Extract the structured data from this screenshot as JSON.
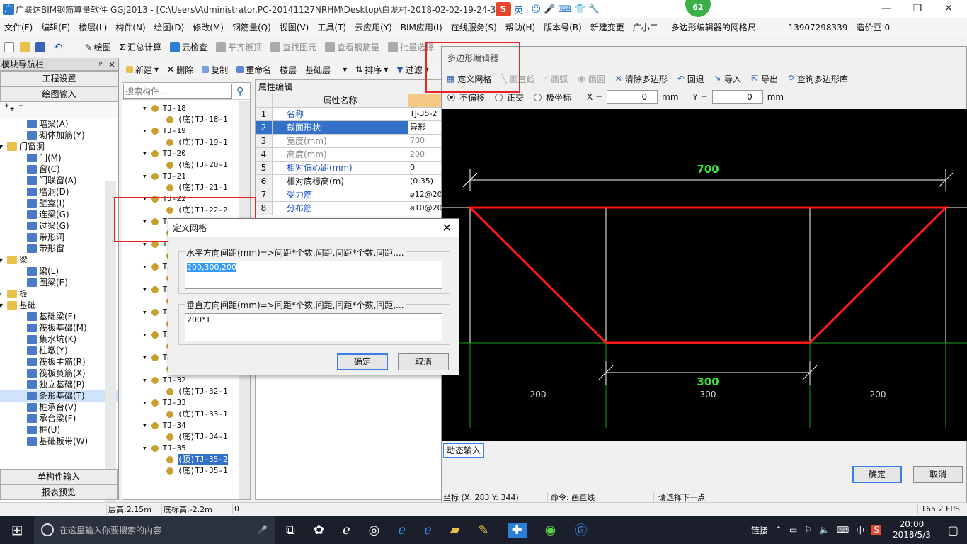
{
  "window": {
    "title": "广联达BIM钢筋算量软件 GGJ2013 - [C:\\Users\\Administrator.PC-20141127NRHM\\Desktop\\白龙村-2018-02-02-19-24-35",
    "notif_count": "62",
    "ime_label": "英"
  },
  "menubar": [
    "文件(F)",
    "编辑(E)",
    "楼层(L)",
    "构件(N)",
    "绘图(D)",
    "修改(M)",
    "钢筋量(Q)",
    "视图(V)",
    "工具(T)",
    "云应用(Y)",
    "BIM应用(I)",
    "在线服务(S)",
    "帮助(H)",
    "版本号(B)",
    "新建变更",
    "广小二",
    "多边形编辑器的网格尺..",
    "13907298339",
    "造价豆:0"
  ],
  "toolbar1": [
    "绘图",
    "汇总计算",
    "云检查",
    "平齐板顶",
    "查找图元",
    "查看钢筋量",
    "批量选择"
  ],
  "nav": {
    "header": "模块导航栏",
    "pin": "ᵖ",
    "close": "×",
    "btn_project": "工程设置",
    "btn_draw": "绘图输入",
    "tree": [
      {
        "text": "暗梁(A)",
        "indent": 3,
        "icon": "beam"
      },
      {
        "text": "砌体加筋(Y)",
        "indent": 3,
        "icon": "beam"
      },
      {
        "text": "门窗洞",
        "indent": 1,
        "icon": "folder",
        "expand": "▾"
      },
      {
        "text": "门(M)",
        "indent": 3,
        "icon": "door"
      },
      {
        "text": "窗(C)",
        "indent": 3,
        "icon": "window"
      },
      {
        "text": "门联窗(A)",
        "indent": 3,
        "icon": "door"
      },
      {
        "text": "墙洞(D)",
        "indent": 3,
        "icon": "wall"
      },
      {
        "text": "壁龛(I)",
        "indent": 3,
        "icon": "wall"
      },
      {
        "text": "连梁(G)",
        "indent": 3,
        "icon": "beam"
      },
      {
        "text": "过梁(G)",
        "indent": 3,
        "icon": "beam"
      },
      {
        "text": "带形洞",
        "indent": 3,
        "icon": "wall"
      },
      {
        "text": "带形窗",
        "indent": 3,
        "icon": "window"
      },
      {
        "text": "梁",
        "indent": 1,
        "icon": "folder",
        "expand": "▾"
      },
      {
        "text": "梁(L)",
        "indent": 3,
        "icon": "beam"
      },
      {
        "text": "圈梁(E)",
        "indent": 3,
        "icon": "beam"
      },
      {
        "text": "板",
        "indent": 1,
        "icon": "folder",
        "expand": "›"
      },
      {
        "text": "基础",
        "indent": 1,
        "icon": "folder",
        "expand": "▾"
      },
      {
        "text": "基础梁(F)",
        "indent": 3,
        "icon": "beam"
      },
      {
        "text": "筏板基础(M)",
        "indent": 3,
        "icon": "beam"
      },
      {
        "text": "集水坑(K)",
        "indent": 3,
        "icon": "beam"
      },
      {
        "text": "柱墩(Y)",
        "indent": 3,
        "icon": "beam"
      },
      {
        "text": "筏板主筋(R)",
        "indent": 3,
        "icon": "beam"
      },
      {
        "text": "筏板负筋(X)",
        "indent": 3,
        "icon": "beam"
      },
      {
        "text": "独立基础(P)",
        "indent": 3,
        "icon": "beam"
      },
      {
        "text": "条形基础(T)",
        "indent": 3,
        "icon": "beam",
        "selected": true
      },
      {
        "text": "桩承台(V)",
        "indent": 3,
        "icon": "beam"
      },
      {
        "text": "承台梁(F)",
        "indent": 3,
        "icon": "beam"
      },
      {
        "text": "桩(U)",
        "indent": 3,
        "icon": "beam"
      },
      {
        "text": "基础板带(W)",
        "indent": 3,
        "icon": "beam"
      }
    ],
    "btn_single": "单构件输入",
    "btn_report": "报表预览"
  },
  "comptool": [
    "新建",
    "删除",
    "复制",
    "重命名",
    "楼层",
    "基础层",
    "排序",
    "过滤"
  ],
  "search": {
    "placeholder": "搜索构件..."
  },
  "components": [
    {
      "text": "TJ-18",
      "sub": false
    },
    {
      "text": "(底)TJ-18-1",
      "sub": true
    },
    {
      "text": "TJ-19",
      "sub": false
    },
    {
      "text": "(底)TJ-19-1",
      "sub": true
    },
    {
      "text": "TJ-20",
      "sub": false
    },
    {
      "text": "(底)TJ-20-1",
      "sub": true
    },
    {
      "text": "TJ-21",
      "sub": false
    },
    {
      "text": "(底)TJ-21-1",
      "sub": true
    },
    {
      "text": "TJ-22",
      "sub": false
    },
    {
      "text": "(底)TJ-22-2",
      "sub": true
    },
    {
      "text": "TJ-23",
      "sub": false
    },
    {
      "text": "(底)TJ-23-1",
      "sub": true
    },
    {
      "text": "TJ-24",
      "sub": false
    },
    {
      "text": "(底)TJ-24-1",
      "sub": true
    },
    {
      "text": "TJ-25",
      "sub": false
    },
    {
      "text": "(底)TJ-25-1",
      "sub": true
    },
    {
      "text": "TJ-26",
      "sub": false
    },
    {
      "text": "(底)TJ-26-1",
      "sub": true
    },
    {
      "text": "TJ-27",
      "sub": false
    },
    {
      "text": "(底)TJ-27-1",
      "sub": true
    },
    {
      "text": "TJ-28",
      "sub": false
    },
    {
      "text": "(底)TJ-28-1",
      "sub": true
    },
    {
      "text": "TJ-31",
      "sub": false
    },
    {
      "text": "(底)TJ-31-1",
      "sub": true
    },
    {
      "text": "TJ-32",
      "sub": false
    },
    {
      "text": "(底)TJ-32-1",
      "sub": true
    },
    {
      "text": "TJ-33",
      "sub": false
    },
    {
      "text": "(底)TJ-33-1",
      "sub": true
    },
    {
      "text": "TJ-34",
      "sub": false
    },
    {
      "text": "(底)TJ-34-1",
      "sub": true
    },
    {
      "text": "TJ-35",
      "sub": false
    },
    {
      "text": "(顶)TJ-35-2",
      "sub": true,
      "selected": true
    },
    {
      "text": "(底)TJ-35-1",
      "sub": true
    }
  ],
  "props": {
    "tab": "属性编辑",
    "col_name": "属性名称",
    "rows": [
      {
        "n": "1",
        "k": "名称",
        "v": "TJ-35-2",
        "blue": true
      },
      {
        "n": "2",
        "k": "截面形状",
        "v": "异形",
        "blue": true,
        "selected": true
      },
      {
        "n": "3",
        "k": "宽度(mm)",
        "v": "700",
        "gray": true
      },
      {
        "n": "4",
        "k": "高度(mm)",
        "v": "200",
        "gray": true
      },
      {
        "n": "5",
        "k": "相对偏心距(mm)",
        "v": "0",
        "blue": true
      },
      {
        "n": "6",
        "k": "相对底标高(m)",
        "v": "(0.35)"
      },
      {
        "n": "7",
        "k": "受力筋",
        "v": "⌀12@20",
        "blue": true
      },
      {
        "n": "8",
        "k": "分布筋",
        "v": "⌀10@20",
        "blue": true
      }
    ]
  },
  "editor": {
    "title": "多边形编辑器",
    "tools": [
      {
        "label": "定义网格",
        "enabled": true,
        "icon": "grid-icon"
      },
      {
        "label": "画直线",
        "enabled": false,
        "icon": "line-icon"
      },
      {
        "label": "画弧",
        "enabled": false,
        "icon": "arc-icon"
      },
      {
        "label": "画圆",
        "enabled": false,
        "icon": "circle-icon"
      },
      {
        "label": "清除多边形",
        "enabled": true,
        "icon": "clear-icon"
      },
      {
        "label": "回退",
        "enabled": true,
        "icon": "undo-icon"
      },
      {
        "label": "导入",
        "enabled": true,
        "icon": "import-icon"
      },
      {
        "label": "导出",
        "enabled": true,
        "icon": "export-icon"
      },
      {
        "label": "查询多边形库",
        "enabled": true,
        "icon": "search-icon"
      }
    ],
    "radios": [
      "不偏移",
      "正交",
      "极坐标"
    ],
    "x_label": "X =",
    "y_label": "Y =",
    "x_value": "0",
    "y_value": "0",
    "unit": "mm",
    "dim_top": "700",
    "dim_bottom": "300",
    "grid_labels": [
      "200",
      "300",
      "200"
    ],
    "dyn_input": "动态输入",
    "ok": "确定",
    "cancel": "取消",
    "status_coord": "坐标 (X: 283 Y: 344)",
    "status_cmd": "命令: 画直线",
    "status_prompt": "请选择下一点"
  },
  "dialog": {
    "title": "定义网格",
    "h_label": "水平方向间距(mm)=>间距*个数,间距,间距*个数,间距,...",
    "h_value": "200,300,200",
    "v_label": "垂直方向间距(mm)=>间距*个数,间距,间距*个数,间距,...",
    "v_value": "200*1",
    "ok": "确定",
    "cancel": "取消"
  },
  "statusbar": {
    "floor_h": "层高:2.15m",
    "base_h": "底标高:-2.2m",
    "extra": "0",
    "fps": "165.2 FPS"
  },
  "taskbar": {
    "search_placeholder": "在这里输入你要搜索的内容",
    "link": "链接",
    "lang": "中",
    "time": "20:00",
    "date": "2018/5/3"
  },
  "chart_data": {
    "type": "polygon",
    "grid_x_mm": [
      200,
      300,
      200
    ],
    "grid_y_mm": [
      200
    ],
    "polygon_mm": [
      [
        0,
        200
      ],
      [
        700,
        200
      ],
      [
        500,
        0
      ],
      [
        200,
        0
      ]
    ]
  },
  "colors": {
    "highlight": "#e8242a",
    "accent": "#3399ff",
    "canvas": "#000000"
  }
}
